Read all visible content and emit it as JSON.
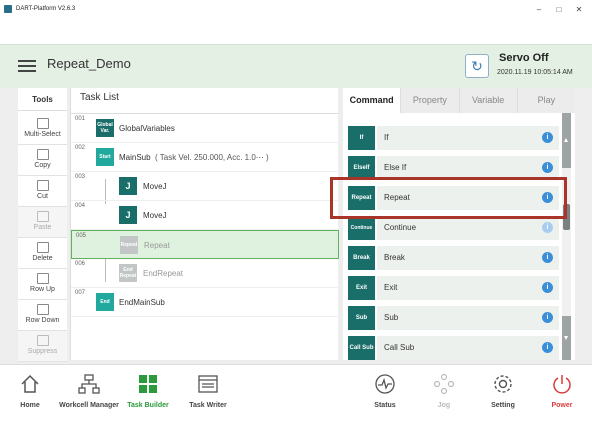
{
  "window": {
    "title": "DART-Platform V2.6.3"
  },
  "header": {
    "project_title": "Repeat_Demo",
    "servo_status": "Servo Off",
    "servo_timestamp": "2020.11.19 10:05:14 AM"
  },
  "tools": {
    "title": "Tools",
    "items": [
      {
        "label": "Multi-Select",
        "enabled": true
      },
      {
        "label": "Copy",
        "enabled": true
      },
      {
        "label": "Cut",
        "enabled": true
      },
      {
        "label": "Paste",
        "enabled": false
      },
      {
        "label": "Delete",
        "enabled": true
      },
      {
        "label": "Row Up",
        "enabled": true
      },
      {
        "label": "Row Down",
        "enabled": true
      },
      {
        "label": "Suppress",
        "enabled": false
      }
    ]
  },
  "task_list": {
    "title": "Task List",
    "rows": [
      {
        "num": "001",
        "block": "Global Var.",
        "text": "GlobalVariables"
      },
      {
        "num": "002",
        "block": "Start",
        "text": "MainSub",
        "params": "( Task Vel. 250.000, Acc. 1.0⋯ )"
      },
      {
        "num": "003",
        "block": "J",
        "text": "MoveJ"
      },
      {
        "num": "004",
        "block": "J",
        "text": "MoveJ"
      },
      {
        "num": "005",
        "block": "Repeat",
        "text": "Repeat"
      },
      {
        "num": "006",
        "block": "End Repeat",
        "text": "EndRepeat"
      },
      {
        "num": "007",
        "block": "End",
        "text": "EndMainSub"
      }
    ]
  },
  "right_panel": {
    "tabs": [
      "Command",
      "Property",
      "Variable",
      "Play"
    ],
    "active_tab": "Command",
    "commands": [
      {
        "block": "If",
        "label": "If"
      },
      {
        "block": "ElseIf",
        "label": "Else If"
      },
      {
        "block": "Repeat",
        "label": "Repeat"
      },
      {
        "block": "Continue",
        "label": "Continue"
      },
      {
        "block": "Break",
        "label": "Break"
      },
      {
        "block": "Exit",
        "label": "Exit"
      },
      {
        "block": "Sub",
        "label": "Sub"
      },
      {
        "block": "Call Sub",
        "label": "Call Sub"
      }
    ],
    "info_glyph": "i",
    "highlighted_command": "Repeat"
  },
  "bottom_nav": {
    "items": [
      "Home",
      "Workcell Manager",
      "Task Builder",
      "Task Writer",
      "Status",
      "Jog",
      "Setting",
      "Power"
    ],
    "active": "Task Builder"
  },
  "colors": {
    "accent_green": "#2a9a3a",
    "block_dark_teal": "#1a6e6a",
    "block_teal": "#21a99d",
    "header_bg": "#e4f0e4",
    "highlight_red": "#a8342a",
    "info_blue": "#3a8fd8",
    "power_red": "#d83c3c"
  }
}
